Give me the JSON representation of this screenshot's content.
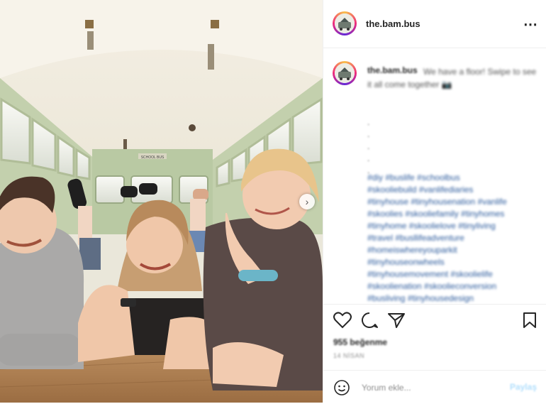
{
  "post": {
    "username": "the.bam.bus",
    "more_icon": "ellipsis-icon",
    "caption_username": "the.bam.bus",
    "caption_text": "We have a floor! Swipe to see it all come together 📷",
    "dot_lines": [
      ".",
      ".",
      ".",
      ".",
      "."
    ],
    "hashtag_lines": [
      "#diy #buslife #schoolbus",
      "#skooliebuild #vanlifediaries",
      "#tinyhouse #tinyhousenation #vanlife",
      "#skoolies #skooliefamily #tinyhomes",
      "#tinyhome #skoolielove #tinyliving",
      "#travel #busllifeadventure",
      "#homeiswhereyouparkit",
      "#tinyhouseonwheels",
      "#tinyhousemovement #skoolielife",
      "#skoolienation #skoolieconversion",
      "#busliving #tinyhousedesign"
    ],
    "likes_text": "955 beğenme",
    "time_text": "14 NİSAN",
    "comment_placeholder": "Yorum ekle...",
    "post_button": "Paylaş",
    "photo_sign_text": "SCHOOL BUS"
  },
  "icons": {
    "like": "heart-icon",
    "comment": "comment-icon",
    "share": "share-icon",
    "save": "bookmark-icon",
    "emoji": "emoji-icon",
    "next": "chevron-right-icon"
  },
  "colors": {
    "accent_link": "#2b5a9c",
    "post_button_disabled": "#b2dffc",
    "bus_interior_green": "#b9c9a3"
  }
}
